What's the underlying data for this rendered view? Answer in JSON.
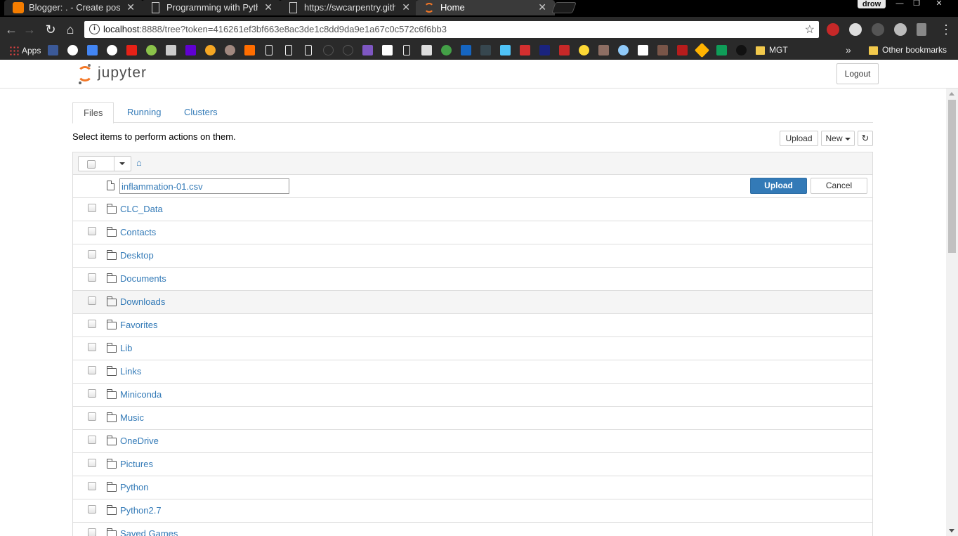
{
  "browser": {
    "tabs": [
      {
        "title": "Blogger: . - Create post",
        "icon": "blogger-icon",
        "active": false
      },
      {
        "title": "Programming with Pytho",
        "icon": "document-icon",
        "active": false
      },
      {
        "title": "https://swcarpentry.githu",
        "icon": "document-icon",
        "active": false
      },
      {
        "title": "Home",
        "icon": "jupyter-icon",
        "active": true
      }
    ],
    "profile_name": "drow",
    "address": {
      "host": "localhost",
      "rest": ":8888/tree?token=416261ef3bf663e8ac3de1c8dd9da9e1a67c0c572c6f6bb3"
    },
    "bookmarks": {
      "apps_label": "Apps",
      "folder_label": "MGT",
      "other_label": "Other bookmarks"
    }
  },
  "jupyter": {
    "logo_text": "jupyter",
    "logout_label": "Logout",
    "tabs": [
      "Files",
      "Running",
      "Clusters"
    ],
    "hint": "Select items to perform actions on them.",
    "toolbar": {
      "upload_label": "Upload",
      "new_label": "New"
    },
    "upload_row": {
      "filename": "inflammation-01.csv",
      "upload_label": "Upload",
      "cancel_label": "Cancel"
    },
    "folders": [
      "CLC_Data",
      "Contacts",
      "Desktop",
      "Documents",
      "Downloads",
      "Favorites",
      "Lib",
      "Links",
      "Miniconda",
      "Music",
      "OneDrive",
      "Pictures",
      "Python",
      "Python2.7",
      "Saved Games"
    ],
    "hovered_folder": "Downloads"
  },
  "colors": {
    "link": "#337ab7",
    "primary": "#337ab7",
    "jupyter_orange": "#f37726"
  }
}
